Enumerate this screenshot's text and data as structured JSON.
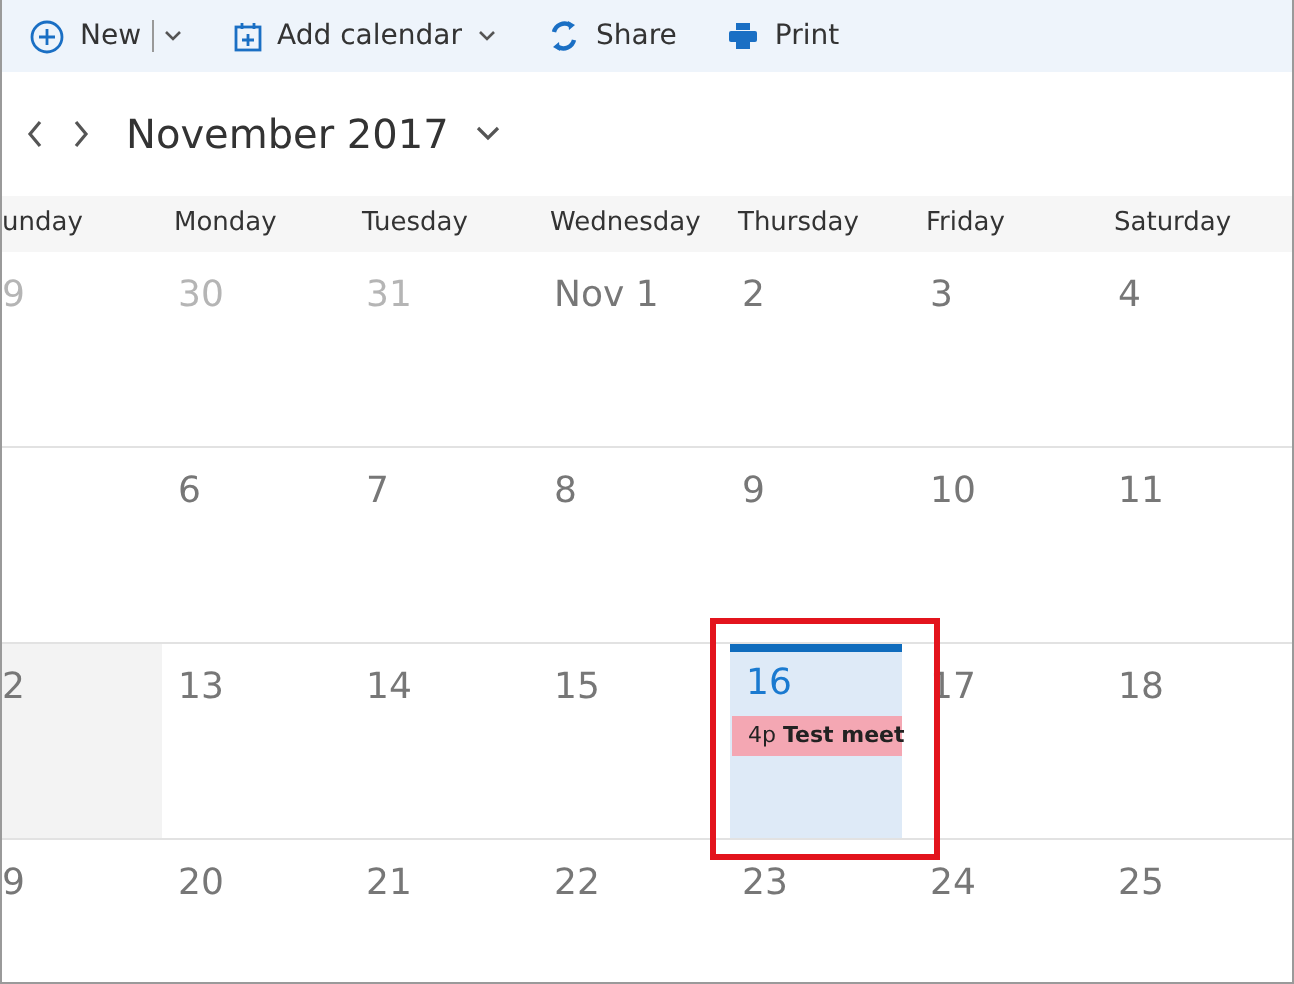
{
  "toolbar": [
    {
      "kind": "new",
      "label": "New",
      "split": true,
      "dropdown": true
    },
    {
      "kind": "calendar",
      "label": "Add calendar",
      "split": false,
      "dropdown": true
    },
    {
      "kind": "share",
      "label": "Share",
      "split": false,
      "dropdown": false
    },
    {
      "kind": "print",
      "label": "Print",
      "split": false,
      "dropdown": false
    }
  ],
  "month": {
    "title": "November 2017"
  },
  "weekdays": [
    "unday",
    "Monday",
    "Tuesday",
    "Wednesday",
    "Thursday",
    "Friday",
    "Saturday"
  ],
  "weeks": [
    [
      {
        "label": "9",
        "muted": true,
        "selected": false,
        "today": false
      },
      {
        "label": "30",
        "muted": true,
        "selected": false,
        "today": false
      },
      {
        "label": "31",
        "muted": true,
        "selected": false,
        "today": false
      },
      {
        "label": "Nov 1",
        "muted": false,
        "selected": false,
        "today": false
      },
      {
        "label": "2",
        "muted": false,
        "selected": false,
        "today": false
      },
      {
        "label": "3",
        "muted": false,
        "selected": false,
        "today": false
      },
      {
        "label": "4",
        "muted": false,
        "selected": false,
        "today": false
      }
    ],
    [
      {
        "label": "6",
        "muted": false,
        "selected": false,
        "today": false
      },
      {
        "label": "7",
        "muted": false,
        "selected": false,
        "today": false
      },
      {
        "label": "8",
        "muted": false,
        "selected": false,
        "today": false
      },
      {
        "label": "9",
        "muted": false,
        "selected": false,
        "today": false
      },
      {
        "label": "10",
        "muted": false,
        "selected": false,
        "today": false
      },
      {
        "label": "11",
        "muted": false,
        "selected": false,
        "today": false
      }
    ],
    [
      {
        "label": "2",
        "muted": false,
        "selected": true,
        "today": false
      },
      {
        "label": "13",
        "muted": false,
        "selected": false,
        "today": false
      },
      {
        "label": "14",
        "muted": false,
        "selected": false,
        "today": false
      },
      {
        "label": "15",
        "muted": false,
        "selected": false,
        "today": false
      },
      {
        "label": "16",
        "muted": false,
        "selected": false,
        "today": true,
        "events": [
          {
            "text": "4p **Test meet**",
            "color": "#f4a7b3"
          }
        ]
      },
      {
        "label": "17",
        "muted": false,
        "selected": false,
        "today": false
      },
      {
        "label": "18",
        "muted": false,
        "selected": false,
        "today": false
      }
    ],
    [
      {
        "label": "9",
        "muted": false,
        "selected": false,
        "today": false
      },
      {
        "label": "20",
        "muted": false,
        "selected": false,
        "today": false
      },
      {
        "label": "21",
        "muted": false,
        "selected": false,
        "today": false
      },
      {
        "label": "22",
        "muted": false,
        "selected": false,
        "today": false
      },
      {
        "label": "23",
        "muted": false,
        "selected": false,
        "today": false
      },
      {
        "label": "24",
        "muted": false,
        "selected": false,
        "today": false
      },
      {
        "label": "25",
        "muted": false,
        "selected": false,
        "today": false
      }
    ]
  ]
}
